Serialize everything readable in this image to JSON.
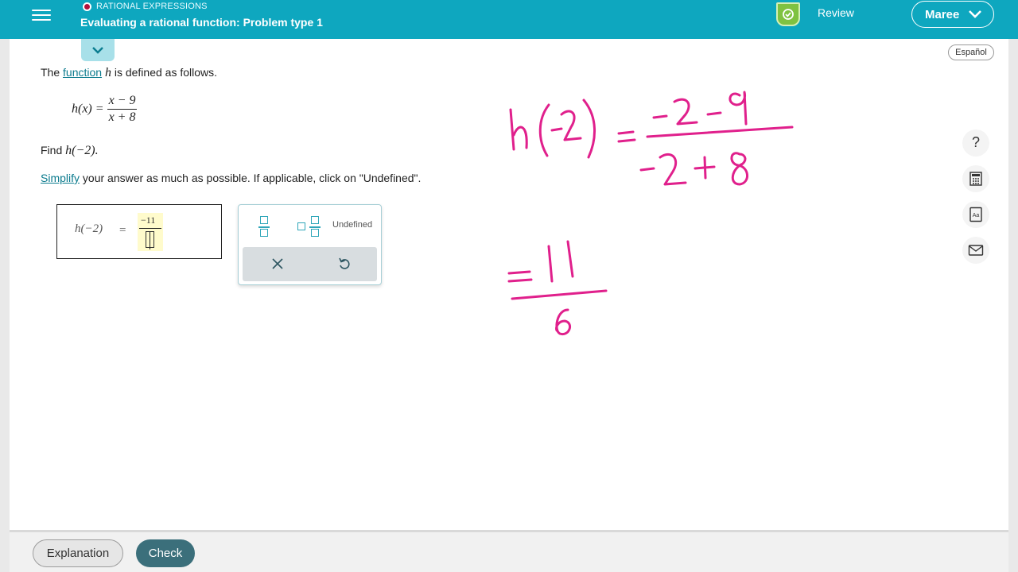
{
  "header": {
    "topic": "RATIONAL EXPRESSIONS",
    "title": "Evaluating a rational function: Problem type 1",
    "review_label": "Review",
    "user_name": "Maree"
  },
  "language_toggle": "Español",
  "problem": {
    "intro_prefix": "The",
    "intro_link": "function",
    "intro_var": "h",
    "intro_suffix": "is defined as follows.",
    "def_lhs": "h(x) =",
    "def_num": "x − 9",
    "def_den": "x + 8",
    "find_prefix": "Find",
    "find_expr": "h(−2).",
    "simplify_link": "Simplify",
    "simplify_suffix": "your answer as much as possible. If applicable, click on \"Undefined\"."
  },
  "answer": {
    "label": "h(−2)",
    "equals": "=",
    "numerator": "−11",
    "denominator": ""
  },
  "toolpad": {
    "undefined_label": "Undefined"
  },
  "side_tools": [
    "help-icon",
    "calculator-icon",
    "dictionary-icon",
    "mail-icon"
  ],
  "handwriting": {
    "line1": "h(-2) = (-2-9)/(-2+8)",
    "line2": "= -11/6"
  },
  "footer": {
    "explanation_label": "Explanation",
    "check_label": "Check"
  },
  "colors": {
    "header": "#0ea7bf",
    "accent_link": "#0a7a8d",
    "check_button": "#3b6f7b",
    "ink": "#e0208c",
    "badge": "#7fc241"
  }
}
